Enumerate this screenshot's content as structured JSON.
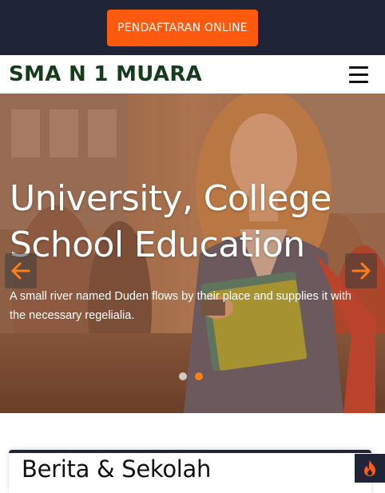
{
  "topbar": {
    "register_button": "PENDAFTARAN ONLINE",
    "button_color": "#fd5a0f",
    "background_color": "#1f2537"
  },
  "navbar": {
    "brand": "SMA N 1 MUARA",
    "brand_color": "#163c1b",
    "menu_icon": "hamburger-icon"
  },
  "hero": {
    "title_line_1": "University, College",
    "title_line_2": "School Education",
    "subtitle": "A small river named Duden flows by their place and supplies it with the necessary regelialia.",
    "prev_icon": "arrow-left-icon",
    "next_icon": "arrow-right-icon",
    "slide_count": 2,
    "active_slide": 2,
    "overlay_color": "#e8763a"
  },
  "news": {
    "heading": "Berita & Sekolah"
  },
  "floating_button": {
    "icon": "fire-icon"
  }
}
